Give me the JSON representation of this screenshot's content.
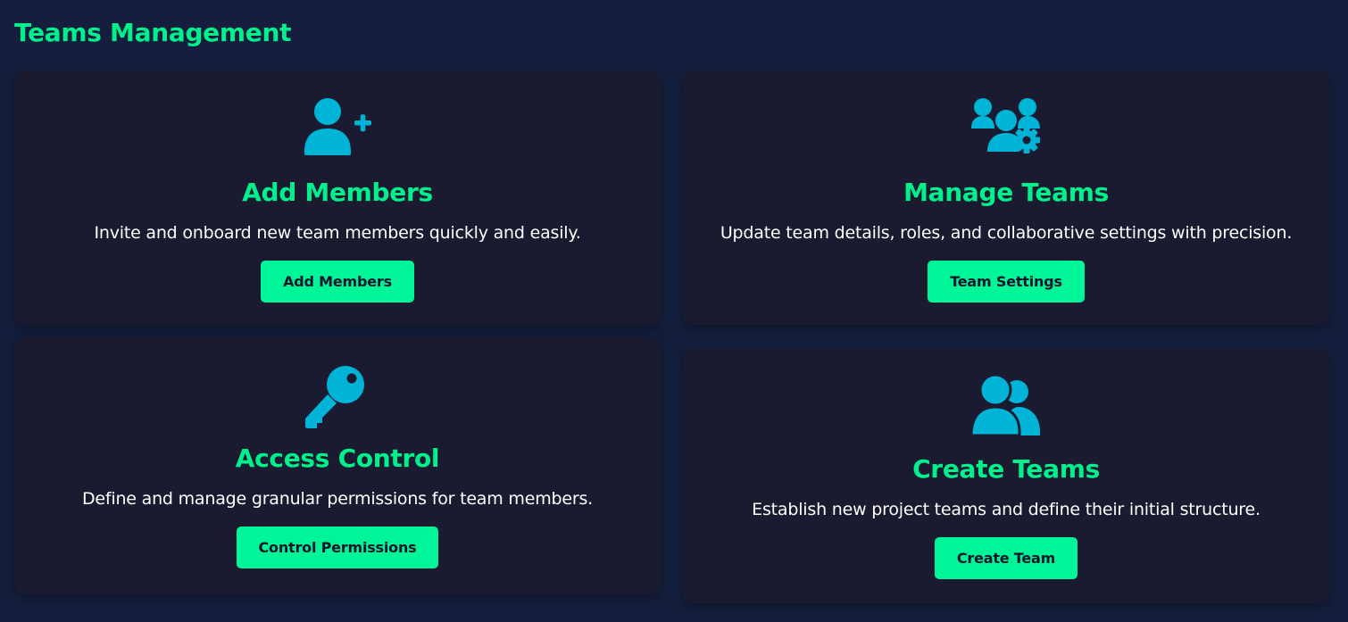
{
  "page": {
    "title": "Teams Management"
  },
  "theme": {
    "background": "#151f3d",
    "card_background": "#1a1b30",
    "accent": "#00f08c",
    "icon_color": "#00b4d8",
    "button_background": "#00f599",
    "button_text": "#10142a"
  },
  "cards": [
    {
      "icon": "user-plus-icon",
      "title": "Add Members",
      "description": "Invite and onboard new team members quickly and easily.",
      "button_label": "Add Members"
    },
    {
      "icon": "users-gear-icon",
      "title": "Manage Teams",
      "description": "Update team details, roles, and collaborative settings with precision.",
      "button_label": "Team Settings"
    },
    {
      "icon": "key-icon",
      "title": "Access Control",
      "description": "Define and manage granular permissions for team members.",
      "button_label": "Control Permissions"
    },
    {
      "icon": "user-group-icon",
      "title": "Create Teams",
      "description": "Establish new project teams and define their initial structure.",
      "button_label": "Create Team"
    }
  ]
}
